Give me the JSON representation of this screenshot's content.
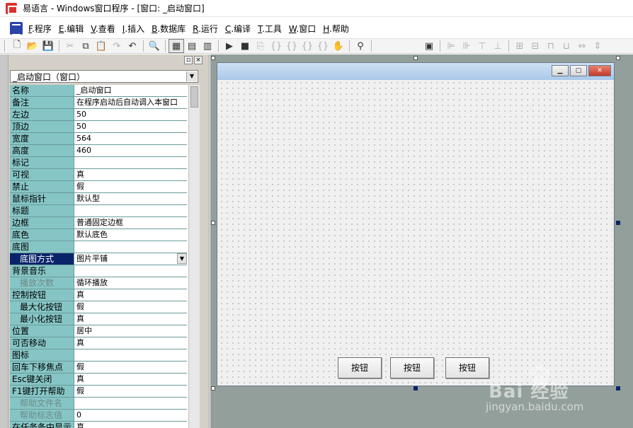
{
  "window": {
    "title": "易语言 - Windows窗口程序 - [窗口: _启动窗口]"
  },
  "menu": [
    {
      "acc": "F",
      "label": ".程序"
    },
    {
      "acc": "E",
      "label": ".编辑"
    },
    {
      "acc": "V",
      "label": ".查看"
    },
    {
      "acc": "I",
      "label": ".插入"
    },
    {
      "acc": "B",
      "label": ".数据库"
    },
    {
      "acc": "R",
      "label": ".运行"
    },
    {
      "acc": "C",
      "label": ".编译"
    },
    {
      "acc": "T",
      "label": ".工具"
    },
    {
      "acc": "W",
      "label": ".窗口"
    },
    {
      "acc": "H",
      "label": ".帮助"
    }
  ],
  "toolbar": {
    "icons": [
      "new-file-icon",
      "open-file-icon",
      "save-icon",
      "cut-icon",
      "copy-icon",
      "paste-icon",
      "redo-icon",
      "undo-icon",
      "find-icon",
      "layout-1-icon",
      "layout-2-icon",
      "layout-3-icon",
      "run-icon",
      "stop-icon",
      "step-icon",
      "step-in-icon",
      "step-out-icon",
      "step-over-icon",
      "step-back-icon",
      "pause-icon",
      "binoculars-icon",
      "form-icon",
      "align-left-icon",
      "align-center-icon",
      "align-top-icon",
      "align-middle-icon",
      "same-width-icon",
      "same-height-icon",
      "distribute-icon",
      "spacing-icon",
      "fit-icon",
      "spacing-v-icon"
    ]
  },
  "property_panel": {
    "object_selector": "_启动窗口（窗口）",
    "rows": [
      {
        "name": "名称",
        "value": "_启动窗口"
      },
      {
        "name": "备注",
        "value": "在程序启动后自动调入本窗口"
      },
      {
        "name": "左边",
        "value": "50"
      },
      {
        "name": "顶边",
        "value": "50"
      },
      {
        "name": "宽度",
        "value": "564"
      },
      {
        "name": "高度",
        "value": "460"
      },
      {
        "name": "标记",
        "value": ""
      },
      {
        "name": "可视",
        "value": "真"
      },
      {
        "name": "禁止",
        "value": "假"
      },
      {
        "name": "鼠标指针",
        "value": "默认型"
      },
      {
        "name": "标题",
        "value": ""
      },
      {
        "name": "边框",
        "value": "普通固定边框"
      },
      {
        "name": "底色",
        "value": "默认底色"
      },
      {
        "name": "底图",
        "value": ""
      },
      {
        "name": "底图方式",
        "value": "图片平铺"
      },
      {
        "name": "背景音乐",
        "value": ""
      },
      {
        "name": "播放次数",
        "value": "循环播放"
      },
      {
        "name": "控制按钮",
        "value": "真"
      },
      {
        "name": "最大化按钮",
        "value": "假"
      },
      {
        "name": "最小化按钮",
        "value": "真"
      },
      {
        "name": "位置",
        "value": "居中"
      },
      {
        "name": "可否移动",
        "value": "真"
      },
      {
        "name": "图标",
        "value": ""
      },
      {
        "name": "回车下移焦点",
        "value": "假"
      },
      {
        "name": "Esc键关闭",
        "value": "真"
      },
      {
        "name": "F1键打开帮助",
        "value": "假"
      },
      {
        "name": "帮助文件名",
        "value": ""
      },
      {
        "name": "帮助标志值",
        "value": "0"
      },
      {
        "name": "在任务条中显示",
        "value": "真"
      }
    ]
  },
  "form": {
    "buttons": [
      "按钮",
      "按钮",
      "按钮"
    ]
  },
  "watermark": {
    "text": "Bai 经验",
    "url": "jingyan.baidu.com"
  }
}
